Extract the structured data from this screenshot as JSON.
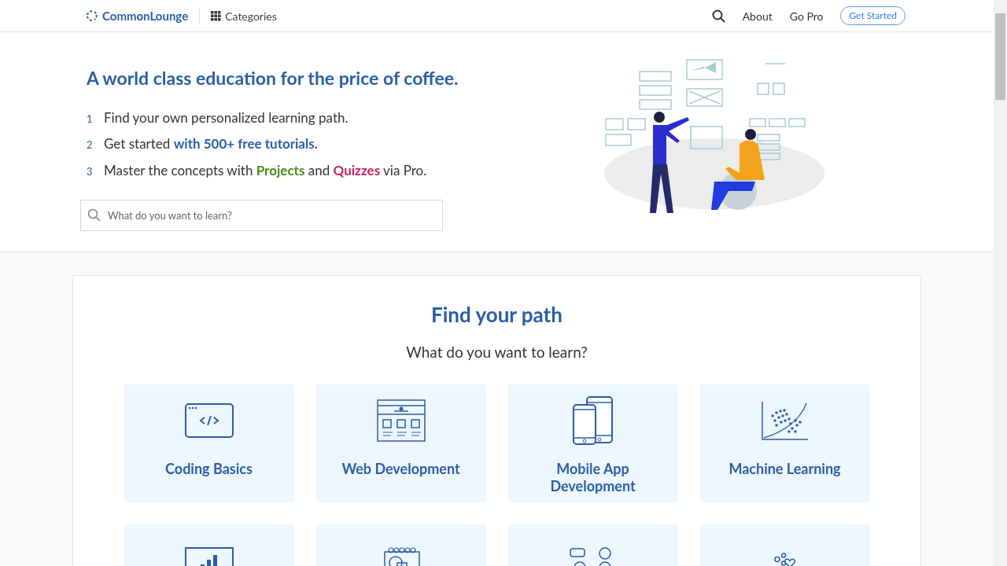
{
  "header": {
    "logo": "CommonLounge",
    "categories": "Categories",
    "links": [
      "About",
      "Go Pro"
    ],
    "cta": "Get Started"
  },
  "hero": {
    "title": "A world class education for the price of coffee.",
    "steps": [
      {
        "number": "1",
        "segments": [
          {
            "text": "Find your own personalized learning path.",
            "kind": "plain"
          }
        ]
      },
      {
        "number": "2",
        "segments": [
          {
            "text": "Get started ",
            "kind": "plain"
          },
          {
            "text": "with 500+ free tutorials.",
            "kind": "blue"
          }
        ]
      },
      {
        "number": "3",
        "segments": [
          {
            "text": "Master the concepts with ",
            "kind": "plain"
          },
          {
            "text": "Projects",
            "kind": "green"
          },
          {
            "text": " and ",
            "kind": "plain"
          },
          {
            "text": "Quizzes",
            "kind": "pink"
          },
          {
            "text": " via Pro.",
            "kind": "plain"
          }
        ]
      }
    ],
    "search": {
      "placeholder": "What do you want to learn?"
    }
  },
  "paths": {
    "title": "Find your path",
    "subtitle": "What do you want to learn?",
    "cards": [
      {
        "kind": "code",
        "label": "Coding Basics"
      },
      {
        "kind": "web",
        "label": "Web Development"
      },
      {
        "kind": "mobile",
        "label": "Mobile App Development"
      },
      {
        "kind": "ml",
        "label": "Machine Learning"
      },
      {
        "kind": "chart"
      },
      {
        "kind": "design"
      },
      {
        "kind": "people"
      },
      {
        "kind": "social"
      }
    ]
  }
}
